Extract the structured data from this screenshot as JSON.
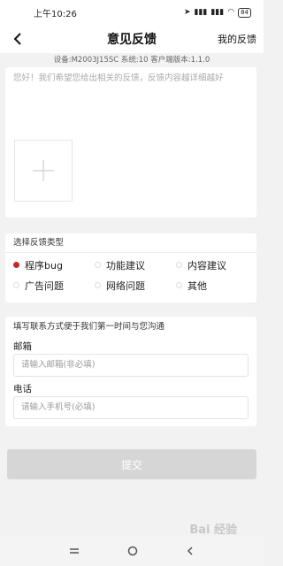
{
  "status_bar": {
    "time": "上午10:26",
    "battery": "84"
  },
  "nav": {
    "title": "意见反馈",
    "right_link": "我的反馈"
  },
  "device_info": "设备:M2003J15SC   系统:10   客户端版本:1.1.0",
  "feedback": {
    "placeholder": "您好！我们希望您给出相关的反馈，反馈内容越详细越好"
  },
  "type_section": {
    "title": "选择反馈类型",
    "options": [
      "程序bug",
      "功能建议",
      "内容建议",
      "广告问题",
      "网络问题",
      "其他"
    ],
    "selected": "程序bug"
  },
  "contact": {
    "title": "填写联系方式便于我们第一时间与您沟通",
    "email_label": "邮箱",
    "email_placeholder": "请输入邮箱(非必填)",
    "phone_label": "电话",
    "phone_placeholder": "请输入手机号(必填)"
  },
  "submit_label": "提交",
  "watermark": "Bai 经验",
  "colors": {
    "accent": "#c62828",
    "submit_disabled": "#d6d6d6"
  },
  "icons": [
    "back-icon",
    "add-photo-icon",
    "location-icon",
    "signal-icon",
    "wifi-icon",
    "battery-icon",
    "menu-icon",
    "home-icon",
    "back-nav-icon"
  ]
}
